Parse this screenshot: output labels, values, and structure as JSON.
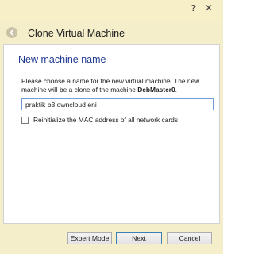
{
  "titlebar": {
    "help_glyph": "?",
    "close_glyph": "✕"
  },
  "header": {
    "title": "Clone Virtual Machine",
    "back_icon": "back-arrow-icon"
  },
  "panel": {
    "section_title": "New machine name",
    "description_part1": "Please choose a name for the new virtual machine. The new machine will be a clone of the machine ",
    "source_machine": "DebMaster0",
    "description_part2": ".",
    "name_value": "praktik b3 owncloud eni",
    "reinit_mac_label": "Reinitialize the MAC address of all network cards",
    "reinit_mac_checked": false
  },
  "footer": {
    "expert_mode_label": "Expert Mode",
    "next_label": "Next",
    "cancel_label": "Cancel"
  },
  "colors": {
    "window_bg": "#f5eecb",
    "section_title": "#1f3a93",
    "input_border": "#6f9fd6"
  }
}
